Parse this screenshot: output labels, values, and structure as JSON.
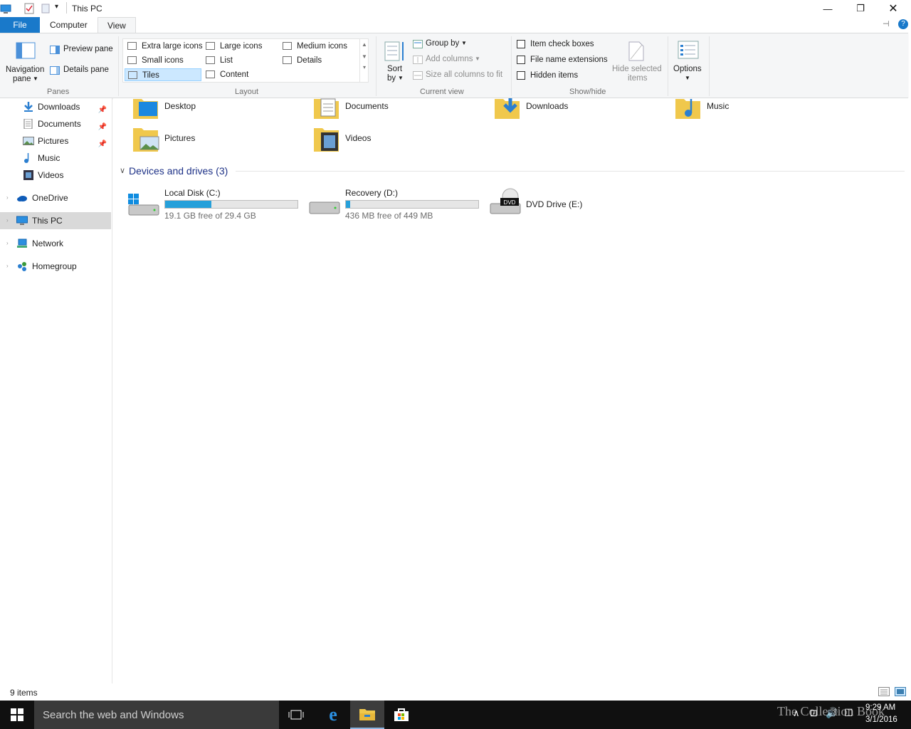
{
  "window": {
    "title": "This PC"
  },
  "tabs": {
    "file": "File",
    "computer": "Computer",
    "view": "View"
  },
  "ribbon": {
    "panes": {
      "label": "Panes",
      "navigation_pane": "Navigation",
      "navigation_pane_2": "pane",
      "preview_pane": "Preview pane",
      "details_pane": "Details pane"
    },
    "layout": {
      "label": "Layout",
      "items": [
        "Extra large icons",
        "Large icons",
        "Medium icons",
        "Small icons",
        "List",
        "Details",
        "Tiles",
        "Content"
      ],
      "selected": "Tiles"
    },
    "current_view": {
      "label": "Current view",
      "sort_by": "Sort",
      "sort_by_2": "by",
      "group_by": "Group by",
      "add_columns": "Add columns",
      "size_all_columns": "Size all columns to fit"
    },
    "show_hide": {
      "label": "Show/hide",
      "item_check_boxes": "Item check boxes",
      "file_name_extensions": "File name extensions",
      "hidden_items": "Hidden items",
      "hide_selected": "Hide selected",
      "hide_selected_2": "items"
    },
    "options": "Options"
  },
  "nav": {
    "items": [
      {
        "label": "Downloads",
        "pinned": true
      },
      {
        "label": "Documents",
        "pinned": true
      },
      {
        "label": "Pictures",
        "pinned": true
      },
      {
        "label": "Music",
        "pinned": false
      },
      {
        "label": "Videos",
        "pinned": false
      },
      {
        "label": "OneDrive"
      },
      {
        "label": "This PC",
        "selected": true
      },
      {
        "label": "Network"
      },
      {
        "label": "Homegroup"
      }
    ]
  },
  "folders": [
    "Desktop",
    "Documents",
    "Downloads",
    "Music",
    "Pictures",
    "Videos"
  ],
  "devices_header": "Devices and drives (3)",
  "drives": [
    {
      "name": "Local Disk (C:)",
      "free": "19.1 GB free of 29.4 GB",
      "used_fraction": 0.35
    },
    {
      "name": "Recovery (D:)",
      "free": "436 MB free of 449 MB",
      "used_fraction": 0.03
    },
    {
      "name": "DVD Drive (E:)"
    }
  ],
  "status": {
    "count": "9 items"
  },
  "taskbar": {
    "search_placeholder": "Search the web and Windows",
    "time": "9:29 AM",
    "date": "3/1/2016",
    "watermark": "The Collection Book"
  },
  "colors": {
    "accent": "#1979ca",
    "drive_bar": "#26a0da",
    "selection": "#cce8ff"
  }
}
